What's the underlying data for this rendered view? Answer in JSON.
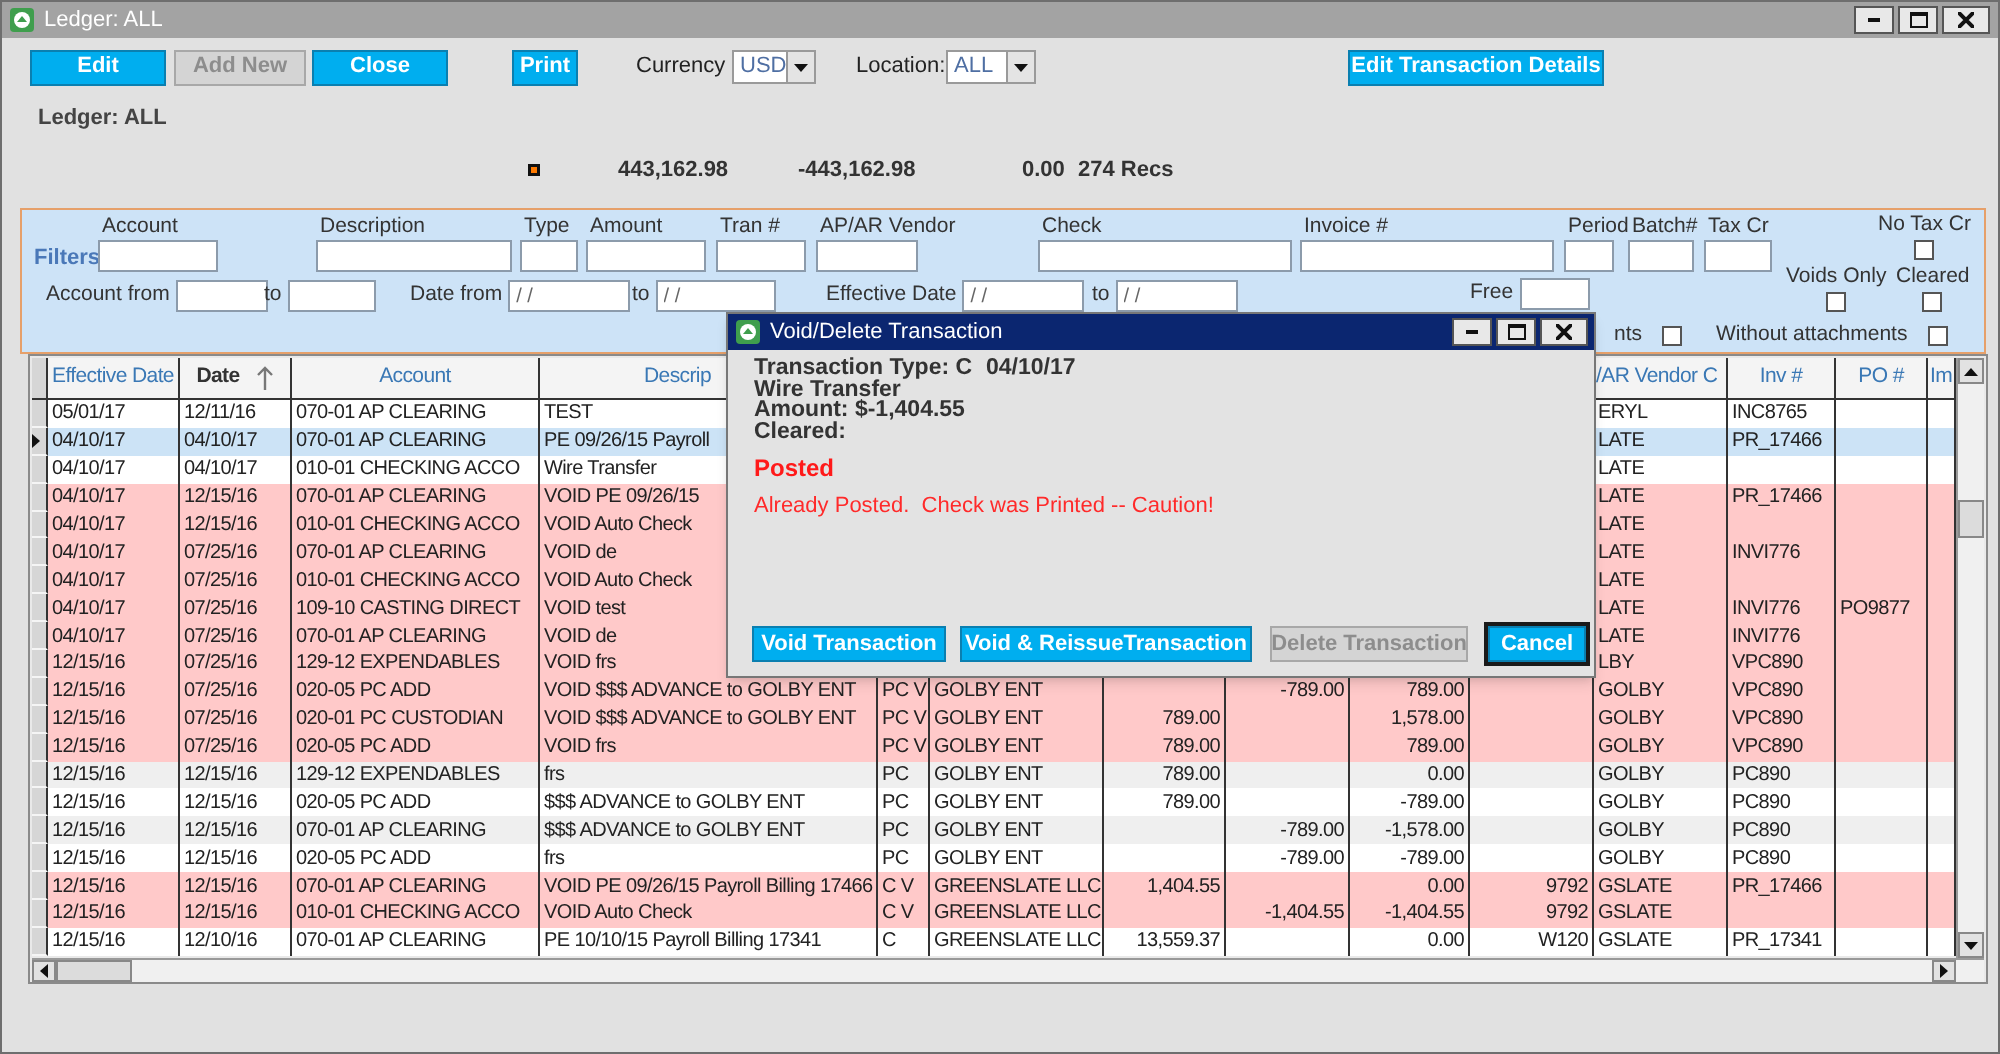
{
  "window": {
    "title": "Ledger: ALL"
  },
  "toolbar": {
    "buttons": [
      {
        "label": "Edit",
        "disabled": false
      },
      {
        "label": "Add New",
        "disabled": true
      },
      {
        "label": "Close",
        "disabled": false
      },
      {
        "label": "Print",
        "disabled": false
      }
    ],
    "currency": {
      "label": "Currency",
      "value": "USD"
    },
    "location": {
      "label": "Location:",
      "value": "ALL"
    },
    "details_button": {
      "label": "Edit Transaction Details",
      "disabled": false
    }
  },
  "ledger_label": "Ledger: ALL",
  "totals": [
    "443,162.98",
    "-443,162.98",
    "0.00",
    "274 Recs"
  ],
  "filters": {
    "title": "Filters",
    "items": [
      {
        "kind": "stacked",
        "label": "Account"
      },
      {
        "kind": "stacked",
        "label": "Description"
      },
      {
        "kind": "stacked",
        "label": "Type"
      },
      {
        "kind": "stacked",
        "label": "Amount"
      },
      {
        "kind": "stacked",
        "label": "Tran #"
      },
      {
        "kind": "stacked",
        "label": "AP/AR Vendor"
      },
      {
        "kind": "stacked",
        "label": "Check"
      },
      {
        "kind": "stacked",
        "label": "Invoice #"
      },
      {
        "kind": "stacked",
        "label": "Period"
      },
      {
        "kind": "stacked",
        "label": "Batch#"
      },
      {
        "kind": "stacked",
        "label": "Tax Cr"
      },
      {
        "kind": "checkbox",
        "label": "No Tax Cr",
        "checked": false
      },
      {
        "kind": "inline",
        "label": "Account from"
      },
      {
        "kind": "inline",
        "label": "to"
      },
      {
        "kind": "inline",
        "label": "Date from",
        "value": "/ /"
      },
      {
        "kind": "inline",
        "label": "to",
        "value": "/ /"
      },
      {
        "kind": "inline",
        "label": "Effective Date",
        "value": "/ /"
      },
      {
        "kind": "inline",
        "label": "to",
        "value": "/ /"
      },
      {
        "kind": "inline",
        "label": "Free"
      },
      {
        "kind": "checkbox",
        "label": "Voids Only",
        "checked": false
      },
      {
        "kind": "checkbox",
        "label": "Cleared",
        "checked": false
      },
      {
        "kind": "checkbox_inline",
        "label": "nts",
        "checked": false
      },
      {
        "kind": "checkbox_inline",
        "label": "Without attachments",
        "checked": false
      }
    ]
  },
  "table": {
    "columns": [
      {
        "header": "Effective Date",
        "sorted": false
      },
      {
        "header": "Date",
        "sorted": true
      },
      {
        "header": "Account",
        "sorted": false
      },
      {
        "header": "Descrip",
        "sorted": false
      },
      null,
      null,
      null,
      null,
      null,
      null,
      {
        "header": "/AR Vendor C",
        "sorted": false
      },
      {
        "header": "Inv #",
        "sorted": false
      },
      {
        "header": "PO #",
        "sorted": false
      },
      {
        "header": "Im",
        "sorted": false
      }
    ],
    "rows": [
      {
        "kind": "normal",
        "selected": false,
        "cells": [
          "05/01/17",
          "12/11/16",
          "070-01 AP CLEARING",
          "TEST",
          null,
          null,
          null,
          null,
          null,
          null,
          "ERYL",
          "INC8765",
          null,
          null
        ]
      },
      {
        "selected": true,
        "cells": [
          "04/10/17",
          "04/10/17",
          "070-01 AP CLEARING",
          "PE 09/26/15 Payroll",
          null,
          null,
          null,
          null,
          null,
          null,
          "LATE",
          "PR_17466",
          null,
          null
        ]
      },
      {
        "kind": "normal",
        "selected": false,
        "cells": [
          "04/10/17",
          "04/10/17",
          "010-01 CHECKING ACCO",
          "Wire Transfer",
          null,
          null,
          null,
          null,
          null,
          null,
          "LATE",
          null,
          null,
          null
        ]
      },
      {
        "kind": "void",
        "selected": false,
        "cells": [
          "04/10/17",
          "12/15/16",
          "070-01 AP CLEARING",
          "VOID PE 09/26/15",
          null,
          null,
          null,
          null,
          null,
          null,
          "LATE",
          "PR_17466",
          null,
          null
        ]
      },
      {
        "kind": "void",
        "selected": false,
        "cells": [
          "04/10/17",
          "12/15/16",
          "010-01 CHECKING ACCO",
          "VOID Auto Check",
          null,
          null,
          null,
          null,
          null,
          null,
          "LATE",
          null,
          null,
          null
        ]
      },
      {
        "kind": "void",
        "selected": false,
        "cells": [
          "04/10/17",
          "07/25/16",
          "070-01 AP CLEARING",
          "VOID de",
          null,
          null,
          null,
          null,
          null,
          null,
          "LATE",
          "INVI776",
          null,
          null
        ]
      },
      {
        "kind": "void",
        "selected": false,
        "cells": [
          "04/10/17",
          "07/25/16",
          "010-01 CHECKING ACCO",
          "VOID Auto Check",
          null,
          null,
          null,
          null,
          null,
          null,
          "LATE",
          null,
          null,
          null
        ]
      },
      {
        "kind": "void",
        "selected": false,
        "cells": [
          "04/10/17",
          "07/25/16",
          "109-10 CASTING DIRECT",
          "VOID test",
          null,
          null,
          null,
          null,
          null,
          null,
          "LATE",
          "INVI776",
          "PO9877",
          null
        ]
      },
      {
        "kind": "void",
        "selected": false,
        "cells": [
          "04/10/17",
          "07/25/16",
          "070-01 AP CLEARING",
          "VOID de",
          null,
          null,
          null,
          null,
          null,
          null,
          "LATE",
          "INVI776",
          null,
          null
        ]
      },
      {
        "kind": "void",
        "selected": false,
        "cells": [
          "12/15/16",
          "07/25/16",
          "129-12 EXPENDABLES",
          "VOID frs",
          null,
          null,
          null,
          null,
          null,
          null,
          "LBY",
          "VPC890",
          null,
          null
        ]
      },
      {
        "kind": "void",
        "selected": false,
        "cells": [
          "12/15/16",
          "07/25/16",
          "020-05 PC ADD",
          "VOID $$$ ADVANCE to GOLBY ENT",
          "PC V",
          "GOLBY ENT",
          null,
          "-789.00",
          "789.00",
          null,
          "GOLBY",
          "VPC890",
          null,
          null
        ]
      },
      {
        "kind": "void",
        "selected": false,
        "cells": [
          "12/15/16",
          "07/25/16",
          "020-01 PC CUSTODIAN",
          "VOID $$$ ADVANCE to GOLBY ENT",
          "PC V",
          "GOLBY ENT",
          "789.00",
          null,
          "1,578.00",
          null,
          "GOLBY",
          "VPC890",
          null,
          null
        ]
      },
      {
        "kind": "void",
        "selected": false,
        "cells": [
          "12/15/16",
          "07/25/16",
          "020-05 PC ADD",
          "VOID frs",
          "PC V",
          "GOLBY ENT",
          "789.00",
          null,
          "789.00",
          null,
          "GOLBY",
          "VPC890",
          null,
          null
        ]
      },
      {
        "kind": "alt",
        "selected": false,
        "cells": [
          "12/15/16",
          "12/15/16",
          "129-12 EXPENDABLES",
          "frs",
          "PC",
          "GOLBY ENT",
          "789.00",
          null,
          "0.00",
          null,
          "GOLBY",
          "PC890",
          null,
          null
        ]
      },
      {
        "kind": "normal",
        "selected": false,
        "cells": [
          "12/15/16",
          "12/15/16",
          "020-05 PC ADD",
          "$$$ ADVANCE to GOLBY ENT",
          "PC",
          "GOLBY ENT",
          "789.00",
          null,
          "-789.00",
          null,
          "GOLBY",
          "PC890",
          null,
          null
        ]
      },
      {
        "kind": "alt",
        "selected": false,
        "cells": [
          "12/15/16",
          "12/15/16",
          "070-01 AP CLEARING",
          "$$$ ADVANCE to GOLBY ENT",
          "PC",
          "GOLBY ENT",
          null,
          "-789.00",
          "-1,578.00",
          null,
          "GOLBY",
          "PC890",
          null,
          null
        ]
      },
      {
        "kind": "normal",
        "selected": false,
        "cells": [
          "12/15/16",
          "12/15/16",
          "020-05 PC ADD",
          "frs",
          "PC",
          "GOLBY ENT",
          null,
          "-789.00",
          "-789.00",
          null,
          "GOLBY",
          "PC890",
          null,
          null
        ]
      },
      {
        "kind": "void",
        "selected": false,
        "cells": [
          "12/15/16",
          "12/15/16",
          "070-01 AP CLEARING",
          "VOID PE 09/26/15 Payroll Billing 17466",
          "C V",
          "GREENSLATE LLC",
          "1,404.55",
          null,
          "0.00",
          "9792",
          "GSLATE",
          "PR_17466",
          null,
          null
        ]
      },
      {
        "kind": "void",
        "selected": false,
        "cells": [
          "12/15/16",
          "12/15/16",
          "010-01 CHECKING ACCO",
          "VOID Auto Check",
          "C V",
          "GREENSLATE LLC",
          null,
          "-1,404.55",
          "-1,404.55",
          "9792",
          "GSLATE",
          null,
          null,
          null
        ]
      },
      {
        "kind": "normal",
        "selected": false,
        "cells": [
          "12/15/16",
          "12/10/16",
          "070-01 AP CLEARING",
          "PE 10/10/15 Payroll Billing 17341",
          "C",
          "GREENSLATE LLC",
          "13,559.37",
          null,
          "0.00",
          "W120",
          "GSLATE",
          "PR_17341",
          null,
          null
        ]
      }
    ]
  },
  "dialog": {
    "title": "Void/Delete Transaction",
    "type_line": "Transaction Type: C",
    "date": "04/10/17",
    "description": "Wire Transfer",
    "amount": "Amount: $-1,404.55",
    "cleared": "Cleared:",
    "status": "Posted",
    "warning": "Already Posted.  Check was Printed -- Caution!",
    "buttons": [
      {
        "label": "Void Transaction",
        "disabled": false,
        "focused": false
      },
      {
        "label": "Void & ReissueTransaction",
        "disabled": false,
        "focused": false
      },
      {
        "label": "Delete Transaction",
        "disabled": true,
        "focused": false
      },
      {
        "label": "Cancel",
        "disabled": false,
        "focused": true
      }
    ]
  }
}
